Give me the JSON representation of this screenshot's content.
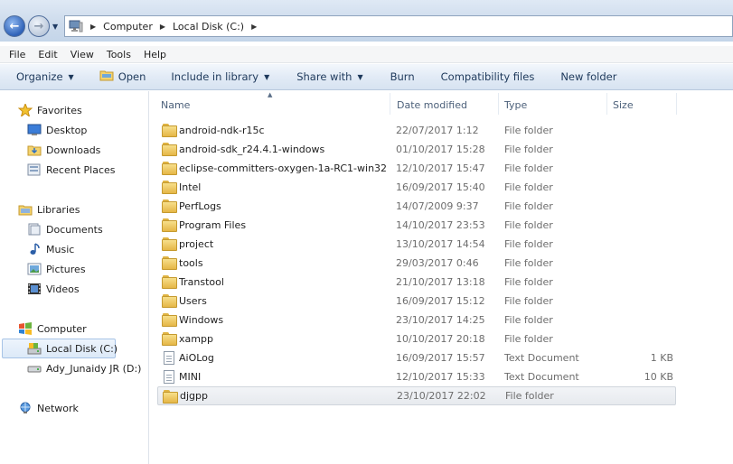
{
  "address": {
    "breadcrumbs": [
      "Computer",
      "Local Disk (C:)"
    ]
  },
  "menu": [
    "File",
    "Edit",
    "View",
    "Tools",
    "Help"
  ],
  "toolbar": {
    "organize": "Organize",
    "open": "Open",
    "include_in_library": "Include in library",
    "share_with": "Share with",
    "burn": "Burn",
    "compatibility_files": "Compatibility files",
    "new_folder": "New folder"
  },
  "nav": {
    "favorites": "Favorites",
    "desktop": "Desktop",
    "downloads": "Downloads",
    "recent_places": "Recent Places",
    "libraries": "Libraries",
    "documents": "Documents",
    "music": "Music",
    "pictures": "Pictures",
    "videos": "Videos",
    "computer": "Computer",
    "local_disk": "Local Disk (C:)",
    "drive_d": "Ady_Junaidy JR (D:)",
    "network": "Network"
  },
  "columns": {
    "name": "Name",
    "date_modified": "Date modified",
    "type": "Type",
    "size": "Size"
  },
  "files": [
    {
      "name": "android-ndk-r15c",
      "date": "22/07/2017 1:12",
      "type": "File folder",
      "size": "",
      "icon": "folder-icon"
    },
    {
      "name": "android-sdk_r24.4.1-windows",
      "date": "01/10/2017 15:28",
      "type": "File folder",
      "size": "",
      "icon": "folder-icon"
    },
    {
      "name": "eclipse-committers-oxygen-1a-RC1-win32",
      "date": "12/10/2017 15:47",
      "type": "File folder",
      "size": "",
      "icon": "folder-icon"
    },
    {
      "name": "Intel",
      "date": "16/09/2017 15:40",
      "type": "File folder",
      "size": "",
      "icon": "folder-icon"
    },
    {
      "name": "PerfLogs",
      "date": "14/07/2009 9:37",
      "type": "File folder",
      "size": "",
      "icon": "folder-icon"
    },
    {
      "name": "Program Files",
      "date": "14/10/2017 23:53",
      "type": "File folder",
      "size": "",
      "icon": "folder-icon"
    },
    {
      "name": "project",
      "date": "13/10/2017 14:54",
      "type": "File folder",
      "size": "",
      "icon": "folder-icon"
    },
    {
      "name": "tools",
      "date": "29/03/2017 0:46",
      "type": "File folder",
      "size": "",
      "icon": "folder-icon"
    },
    {
      "name": "Transtool",
      "date": "21/10/2017 13:18",
      "type": "File folder",
      "size": "",
      "icon": "folder-icon"
    },
    {
      "name": "Users",
      "date": "16/09/2017 15:12",
      "type": "File folder",
      "size": "",
      "icon": "folder-icon"
    },
    {
      "name": "Windows",
      "date": "23/10/2017 14:25",
      "type": "File folder",
      "size": "",
      "icon": "folder-icon"
    },
    {
      "name": "xampp",
      "date": "10/10/2017 20:18",
      "type": "File folder",
      "size": "",
      "icon": "folder-icon"
    },
    {
      "name": "AiOLog",
      "date": "16/09/2017 15:57",
      "type": "Text Document",
      "size": "1 KB",
      "icon": "text-document-icon"
    },
    {
      "name": "MINI",
      "date": "12/10/2017 15:33",
      "type": "Text Document",
      "size": "10 KB",
      "icon": "text-document-icon"
    },
    {
      "name": "djgpp",
      "date": "23/10/2017 22:02",
      "type": "File folder",
      "size": "",
      "icon": "folder-icon"
    }
  ],
  "selected_index": 14
}
